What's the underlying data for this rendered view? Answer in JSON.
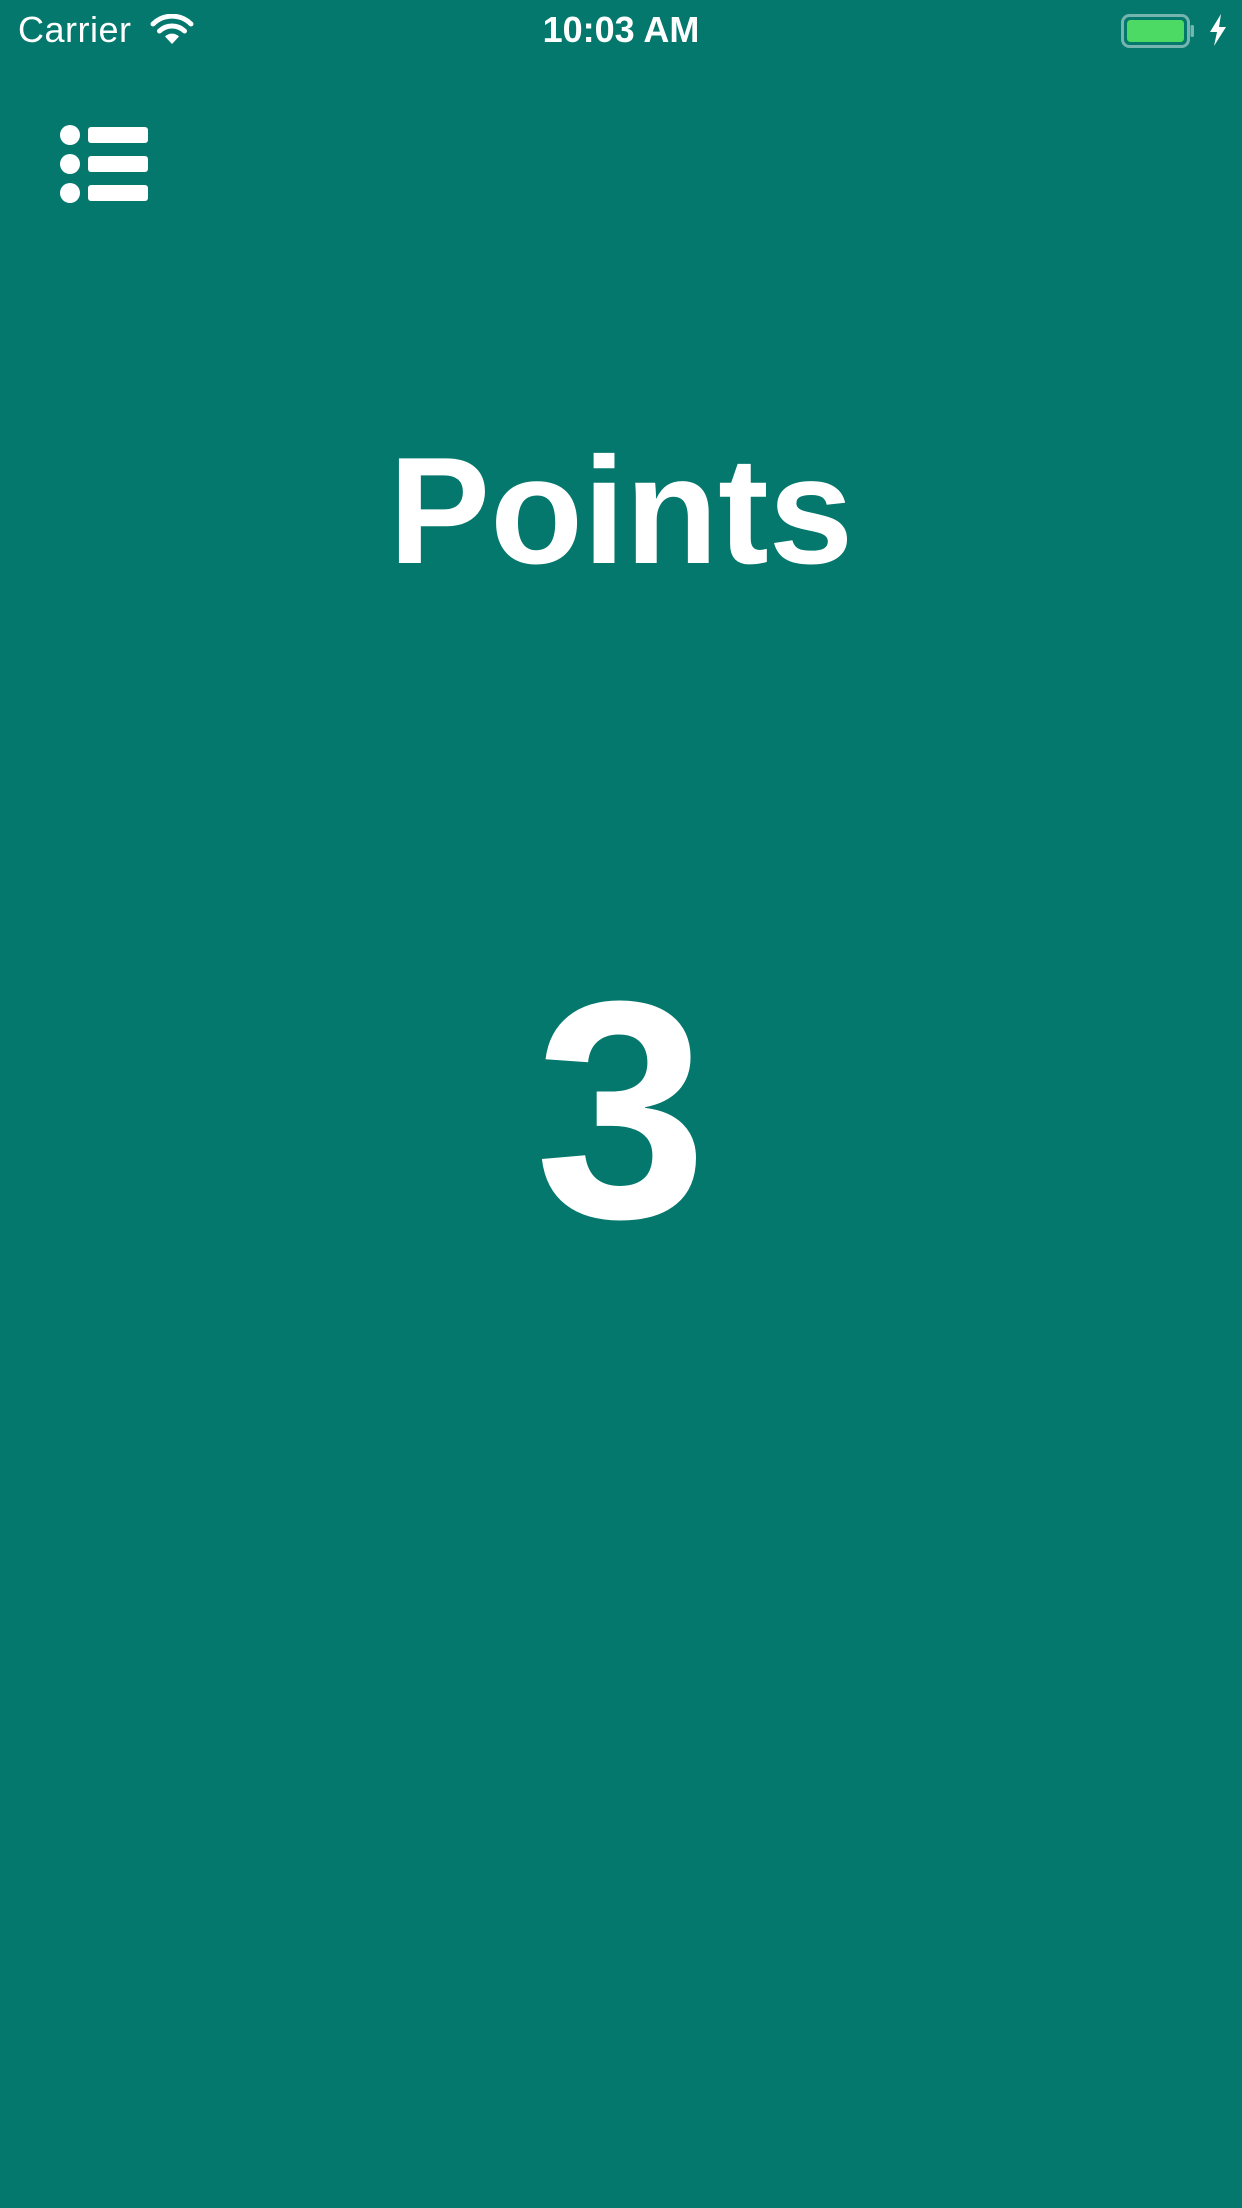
{
  "status_bar": {
    "carrier": "Carrier",
    "time": "10:03 AM",
    "battery_color": "#4CD964",
    "icons": [
      "wifi-icon",
      "battery-icon",
      "charging-icon"
    ]
  },
  "toolbar": {
    "menu_icon": "list-icon"
  },
  "main": {
    "title": "Points",
    "score": "3"
  },
  "colors": {
    "background": "#04786D",
    "text": "#FFFFFF"
  }
}
